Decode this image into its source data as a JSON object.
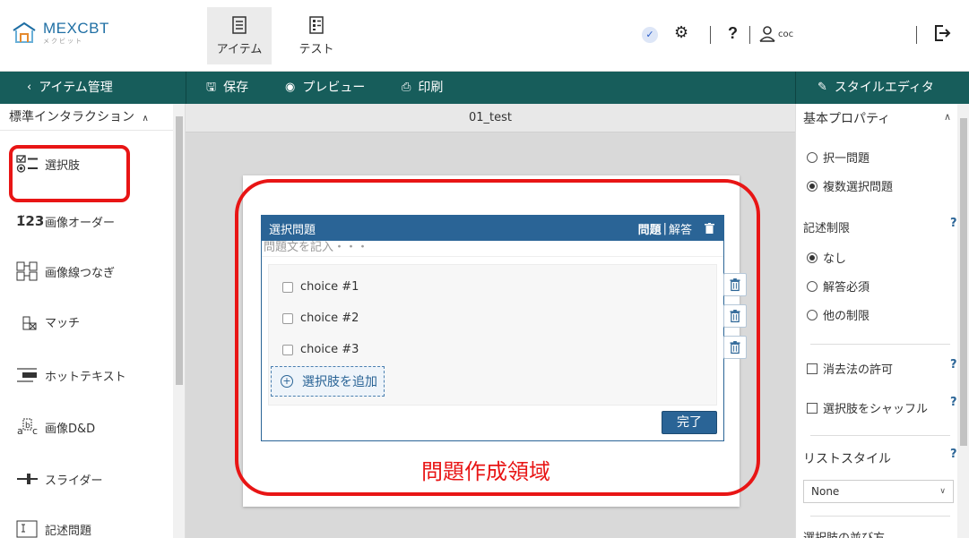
{
  "app": {
    "logo_title": "MEXCBT",
    "logo_sub": "メクビット"
  },
  "topnav": {
    "items": [
      {
        "label": "アイテム",
        "icon": "item-list-icon",
        "active": true
      },
      {
        "label": "テスト",
        "icon": "test-list-icon",
        "active": false
      }
    ]
  },
  "topright": {
    "help_label": "?",
    "username": "coc"
  },
  "toolbar": {
    "back_label": "アイテム管理",
    "save_label": "保存",
    "preview_label": "プレビュー",
    "print_label": "印刷",
    "style_editor_label": "スタイルエディタ"
  },
  "left_panel": {
    "section_title": "標準インタラクション",
    "items": [
      {
        "label": "選択肢",
        "icon": "multiple-choice-icon"
      },
      {
        "label": "画像オーダー",
        "icon": "image-order-icon"
      },
      {
        "label": "画像線つなぎ",
        "icon": "image-line-connect-icon"
      },
      {
        "label": "マッチ",
        "icon": "match-icon"
      },
      {
        "label": "ホットテキスト",
        "icon": "hottext-icon"
      },
      {
        "label": "画像D&D",
        "icon": "image-drag-drop-icon"
      },
      {
        "label": "スライダー",
        "icon": "slider-icon"
      },
      {
        "label": "記述問題",
        "icon": "text-entry-icon"
      }
    ]
  },
  "center": {
    "item_title": "01_test",
    "question": {
      "title": "選択問題",
      "tab_question": "問題",
      "tab_separator": "|",
      "tab_answer": "解答",
      "prompt_placeholder": "問題文を記入・・・",
      "choices": [
        "choice #1",
        "choice #2",
        "choice #3"
      ],
      "add_choice_label": "選択肢を追加",
      "done_label": "完了"
    },
    "annotation_caption": "問題作成領域"
  },
  "right_panel": {
    "section_title": "基本プロパティ",
    "selection_type": [
      {
        "label": "択一問題",
        "selected": false
      },
      {
        "label": "複数選択問題",
        "selected": true
      }
    ],
    "constraint_label": "記述制限",
    "constraints": [
      {
        "label": "なし",
        "selected": true
      },
      {
        "label": "解答必須",
        "selected": false
      },
      {
        "label": "他の制限",
        "selected": false
      }
    ],
    "elimination_label": "消去法の許可",
    "shuffle_label": "選択肢をシャッフル",
    "list_style_label": "リストスタイル",
    "list_style_value": "None",
    "help_mark": "?",
    "next_section_partial": "選択肢の並び方"
  },
  "colors": {
    "toolbar_bg": "#175d5b",
    "question_header": "#2a6496",
    "annotation_red": "#e81515"
  }
}
